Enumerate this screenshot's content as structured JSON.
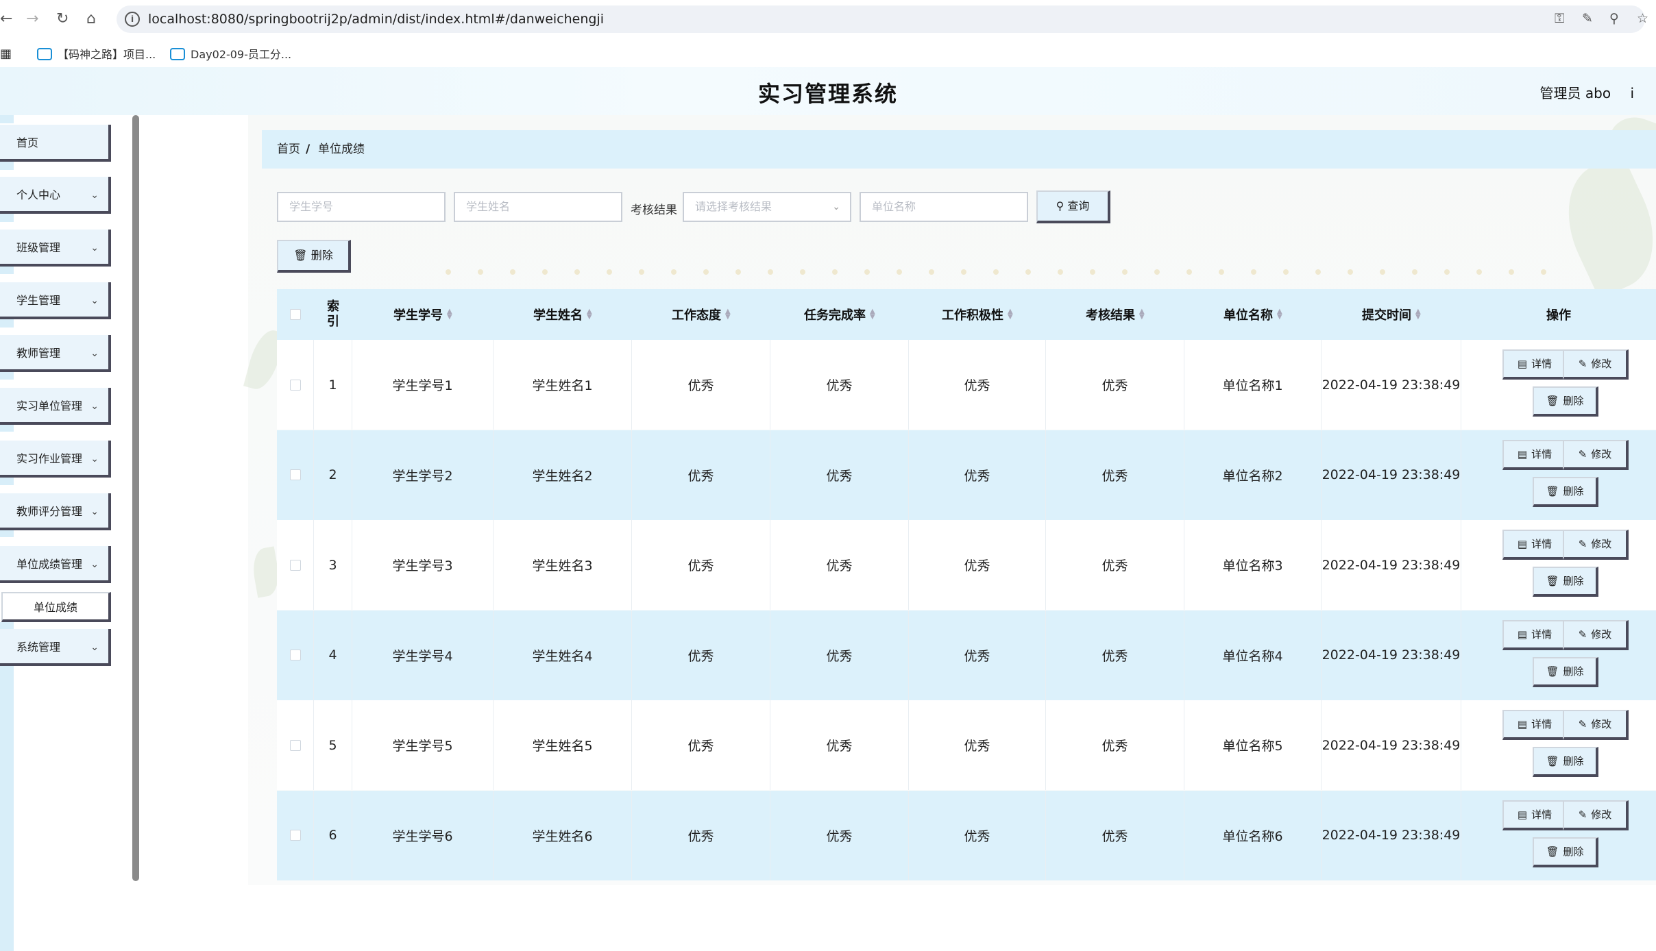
{
  "browser": {
    "url": "localhost:8080/springbootrij2p/admin/dist/index.html#/danweichengji",
    "bookmarks": [
      "【码神之路】项目...",
      "Day02-09-员工分..."
    ]
  },
  "header": {
    "title": "实习管理系统",
    "admin": "管理员 abo",
    "logout_fragment": "i"
  },
  "sidebar": {
    "items": [
      {
        "label": "首页",
        "has_chevron": false
      },
      {
        "label": "个人中心",
        "has_chevron": true
      },
      {
        "label": "班级管理",
        "has_chevron": true
      },
      {
        "label": "学生管理",
        "has_chevron": true
      },
      {
        "label": "教师管理",
        "has_chevron": true
      },
      {
        "label": "实习单位管理",
        "has_chevron": true
      },
      {
        "label": "实习作业管理",
        "has_chevron": true
      },
      {
        "label": "教师评分管理",
        "has_chevron": true
      },
      {
        "label": "单位成绩管理",
        "has_chevron": true
      },
      {
        "label": "系统管理",
        "has_chevron": true
      }
    ],
    "sub_item": "单位成绩"
  },
  "breadcrumb": {
    "home": "首页",
    "sep": "/",
    "current": "单位成绩"
  },
  "search": {
    "student_no_placeholder": "学生学号",
    "student_name_placeholder": "学生姓名",
    "result_label": "考核结果",
    "result_placeholder": "请选择考核结果",
    "unit_placeholder": "单位名称",
    "query_button": "查询",
    "delete_button": "删除"
  },
  "table": {
    "headers": [
      "索引",
      "学生学号",
      "学生姓名",
      "工作态度",
      "任务完成率",
      "工作积极性",
      "考核结果",
      "单位名称",
      "提交时间",
      "操作"
    ],
    "rows": [
      {
        "index": "1",
        "student_no": "学生学号1",
        "student_name": "学生姓名1",
        "attitude": "优秀",
        "completion": "优秀",
        "initiative": "优秀",
        "result": "优秀",
        "unit": "单位名称1",
        "time": "2022-04-19 23:38:49"
      },
      {
        "index": "2",
        "student_no": "学生学号2",
        "student_name": "学生姓名2",
        "attitude": "优秀",
        "completion": "优秀",
        "initiative": "优秀",
        "result": "优秀",
        "unit": "单位名称2",
        "time": "2022-04-19 23:38:49"
      },
      {
        "index": "3",
        "student_no": "学生学号3",
        "student_name": "学生姓名3",
        "attitude": "优秀",
        "completion": "优秀",
        "initiative": "优秀",
        "result": "优秀",
        "unit": "单位名称3",
        "time": "2022-04-19 23:38:49"
      },
      {
        "index": "4",
        "student_no": "学生学号4",
        "student_name": "学生姓名4",
        "attitude": "优秀",
        "completion": "优秀",
        "initiative": "优秀",
        "result": "优秀",
        "unit": "单位名称4",
        "time": "2022-04-19 23:38:49"
      },
      {
        "index": "5",
        "student_no": "学生学号5",
        "student_name": "学生姓名5",
        "attitude": "优秀",
        "completion": "优秀",
        "initiative": "优秀",
        "result": "优秀",
        "unit": "单位名称5",
        "time": "2022-04-19 23:38:49"
      },
      {
        "index": "6",
        "student_no": "学生学号6",
        "student_name": "学生姓名6",
        "attitude": "优秀",
        "completion": "优秀",
        "initiative": "优秀",
        "result": "优秀",
        "unit": "单位名称6",
        "time": "2022-04-19 23:38:49"
      }
    ],
    "actions": {
      "detail": "详情",
      "edit": "修改",
      "delete": "删除"
    }
  }
}
